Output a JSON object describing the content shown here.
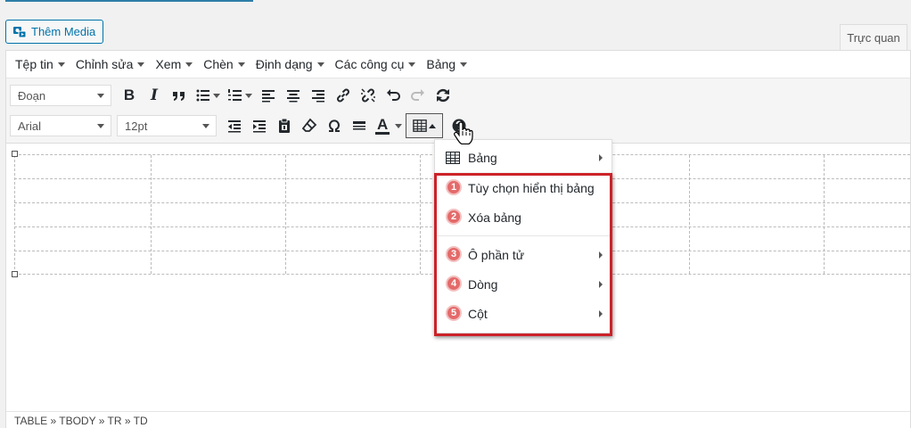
{
  "media_button": {
    "label": "Thêm Media",
    "icon": "media-icon"
  },
  "tab_visual": "Trực quan",
  "menubar": [
    {
      "label": "Tệp tin"
    },
    {
      "label": "Chỉnh sửa"
    },
    {
      "label": "Xem"
    },
    {
      "label": "Chèn"
    },
    {
      "label": "Định dạng"
    },
    {
      "label": "Các công cụ"
    },
    {
      "label": "Bảng"
    }
  ],
  "toolbar": {
    "format_select": "Đoạn",
    "font_select": "Arial",
    "size_select": "12pt",
    "bold": "B",
    "italic": "I",
    "text_color": "A"
  },
  "dropdown": {
    "items": [
      {
        "label": "Bảng",
        "icon": "table-icon",
        "submenu": true
      },
      {
        "label": "Tùy chọn hiển thị bảng",
        "badge": "1",
        "submenu": false
      },
      {
        "label": "Xóa bảng",
        "badge": "2",
        "submenu": false
      },
      {
        "label": "Ô phần tử",
        "badge": "3",
        "submenu": true
      },
      {
        "label": "Dòng",
        "badge": "4",
        "submenu": true
      },
      {
        "label": "Cột",
        "badge": "5",
        "submenu": true
      }
    ]
  },
  "statusbar": "TABLE » TBODY » TR » TD",
  "colors": {
    "accent": "#0073aa",
    "highlight_box": "#cc2229",
    "badge": "#e46a6a"
  }
}
